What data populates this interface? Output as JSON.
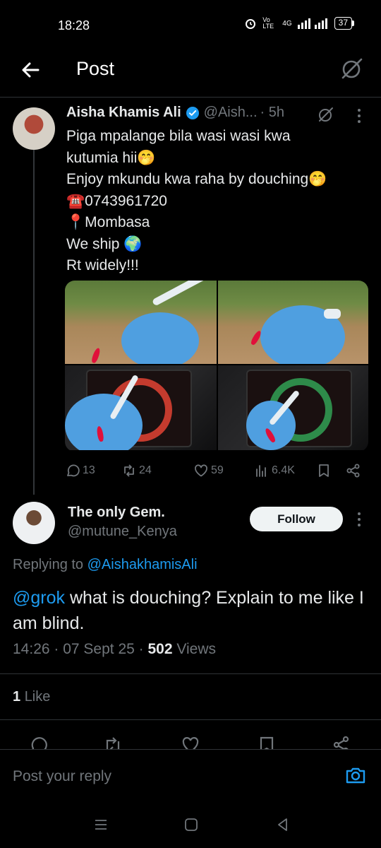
{
  "status_bar": {
    "time": "18:28",
    "network": "Vo LTE",
    "signal": "4G",
    "battery": "37"
  },
  "header": {
    "title": "Post"
  },
  "original_post": {
    "author_name": "Aisha Khamis Ali",
    "author_handle": "@Aish...",
    "time_ago": "· 5h",
    "verified": true,
    "lines": [
      "Piga mpalange bila wasi wasi kwa",
      "kutumia hii🤭",
      "Enjoy mkundu kwa raha by douching🤭",
      "☎️0743961720",
      "📍Mombasa",
      "We ship 🌍",
      "Rt widely!!!"
    ],
    "stats": {
      "replies": "13",
      "reposts": "24",
      "likes": "59",
      "views": "6.4K"
    }
  },
  "reply_post": {
    "author_name": "The only Gem.",
    "author_handle": "@mutune_Kenya",
    "follow_label": "Follow",
    "replying_prefix": "Replying to",
    "replying_to": "@AishakhamisAli",
    "mention": "@grok",
    "text_rest": " what is douching? Explain to me like I am blind.",
    "time": "14:26",
    "date": "07 Sept 25",
    "views_count": "502",
    "views_label": "Views",
    "like_count": "1",
    "like_label": "Like"
  },
  "reply_bar": {
    "placeholder": "Post your reply"
  },
  "colors": {
    "background": "#000000",
    "accent": "#1d9bf0",
    "text": "#e7e9ea",
    "muted": "#71767b",
    "border": "#2f3336"
  }
}
